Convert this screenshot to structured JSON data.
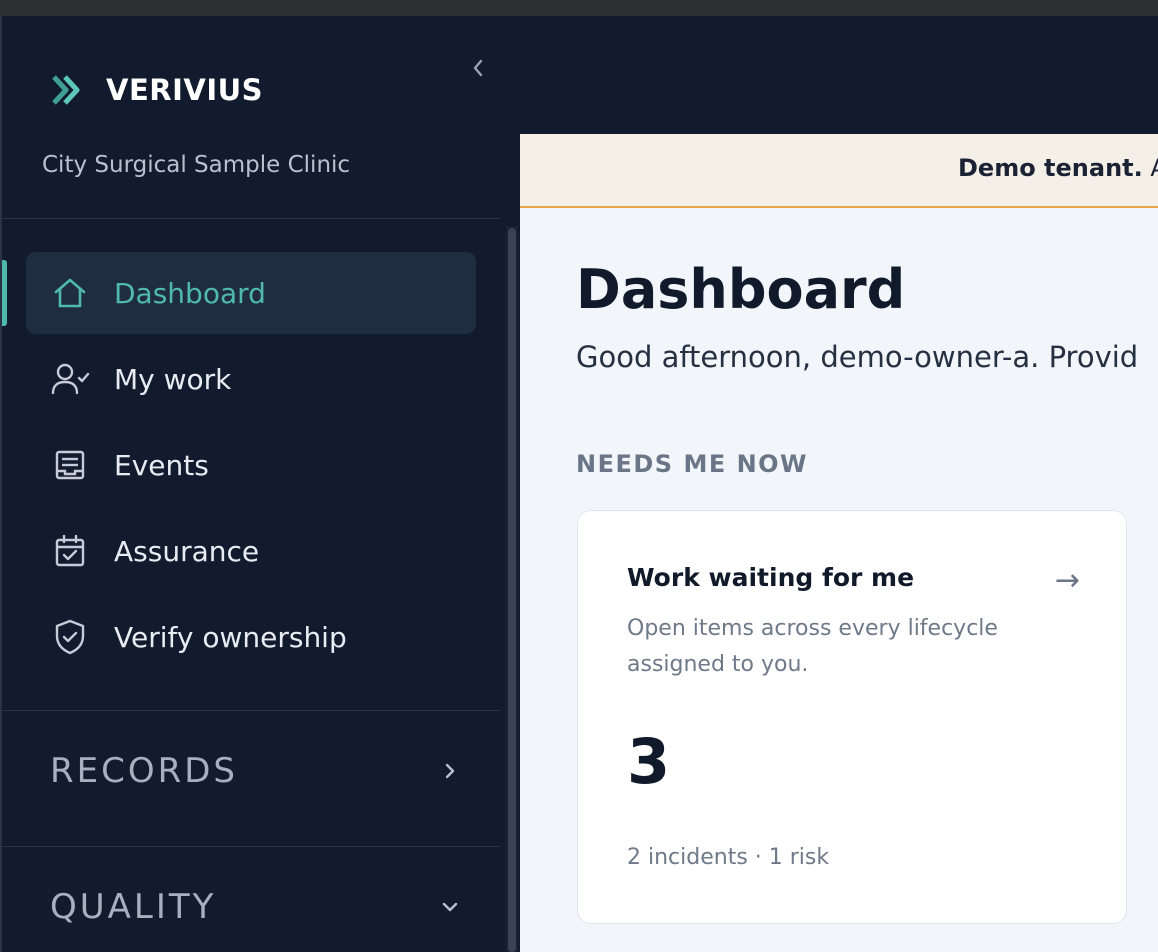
{
  "brand": {
    "name": "VERIVIUS"
  },
  "clinic": {
    "name": "City Surgical Sample Clinic"
  },
  "nav": {
    "items": [
      {
        "label": "Dashboard",
        "icon": "home-icon",
        "active": true
      },
      {
        "label": "My work",
        "icon": "user-check-icon"
      },
      {
        "label": "Events",
        "icon": "inbox-icon"
      },
      {
        "label": "Assurance",
        "icon": "calendar-check-icon"
      },
      {
        "label": "Verify ownership",
        "icon": "shield-check-icon"
      }
    ]
  },
  "sections": {
    "records": {
      "label": "RECORDS",
      "icon": "chevron-right-icon"
    },
    "quality": {
      "label": "QUALITY",
      "icon": "chevron-down-icon"
    }
  },
  "banner": {
    "strong": "Demo tenant.",
    "rest": " Al"
  },
  "main": {
    "title": "Dashboard",
    "greeting": "Good afternoon, demo-owner-a. Provid",
    "needs_label": "NEEDS ME NOW"
  },
  "card": {
    "title": "Work waiting for me",
    "arrow": "→",
    "description": "Open items across every lifecycle assigned to you.",
    "count": "3",
    "footer": "2 incidents · 1 risk"
  },
  "colors": {
    "sidebar_bg": "#121b2d",
    "accent": "#4fb9ad",
    "banner_bg": "#f4f0e8",
    "banner_border": "#e8a44a",
    "main_bg": "#f2f5f9"
  }
}
